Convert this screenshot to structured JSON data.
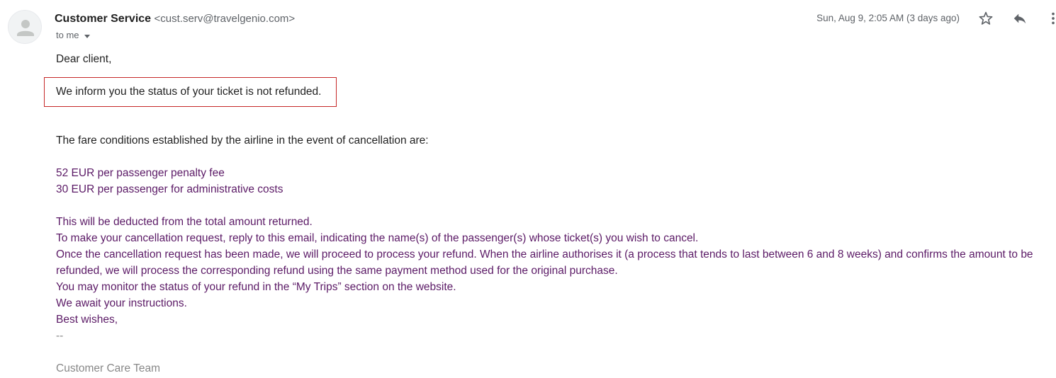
{
  "header": {
    "sender_name": "Customer Service",
    "sender_email": "<cust.serv@travelgenio.com>",
    "to_label": "to me",
    "date": "Sun, Aug 9, 2:05 AM (3 days ago)"
  },
  "icons": {
    "avatar": "person-icon",
    "star": "star-icon",
    "reply": "reply-icon",
    "more": "more-vert-icon",
    "caret": "chevron-down-icon"
  },
  "message": {
    "greeting": "Dear client,",
    "highlighted": "We inform you the status of your ticket is not refunded.",
    "conditions_intro": "The fare conditions established by the airline in the event of cancellation are:",
    "fee_1": "52 EUR per passenger penalty fee",
    "fee_2": "30 EUR per passenger for administrative costs",
    "line_1": "This will be deducted from the total amount returned.",
    "line_2": "To make your cancellation request, reply to this email, indicating the name(s) of the passenger(s) whose ticket(s) you wish to cancel.",
    "line_3": "Once the cancellation request has been made, we will proceed to process your refund. When the airline authorises it (a process that tends to last between 6 and 8 weeks) and confirms the amount to be refunded, we will process the corresponding refund using the same payment method used for the original purchase.",
    "line_4": "You may monitor the status of your refund in the “My Trips” section on the website.",
    "line_5": "We await your instructions.",
    "line_6": "Best wishes,",
    "separator": "--",
    "signature": "Customer Care Team"
  },
  "colors": {
    "highlight_border": "#c62828",
    "body_purple": "#5b1a66",
    "signature_grey": "#888888"
  }
}
